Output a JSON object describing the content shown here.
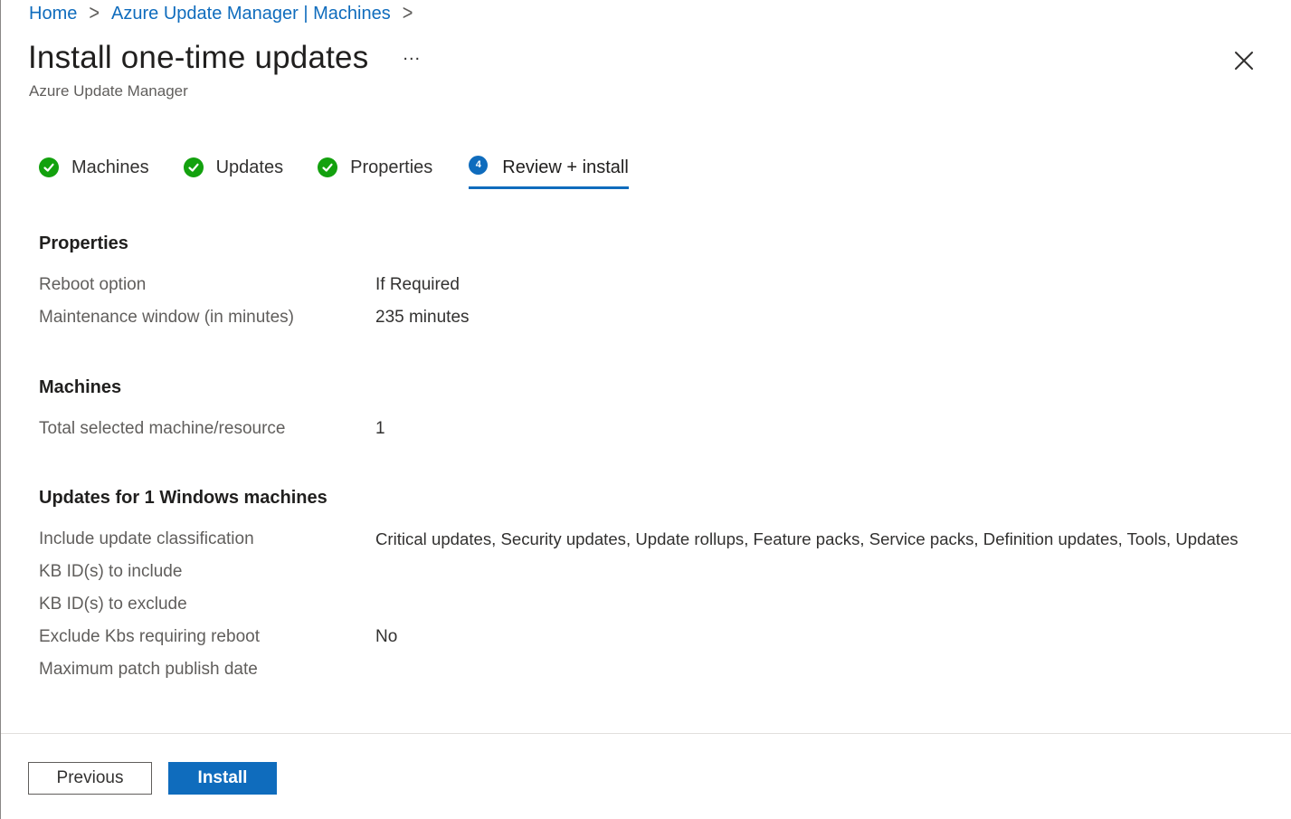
{
  "breadcrumb": {
    "items": [
      "Home",
      "Azure Update Manager | Machines"
    ],
    "separator": ">"
  },
  "header": {
    "title": "Install one-time updates",
    "more": "...",
    "subtitle": "Azure Update Manager"
  },
  "tabs": [
    {
      "label": "Machines",
      "state": "complete"
    },
    {
      "label": "Updates",
      "state": "complete"
    },
    {
      "label": "Properties",
      "state": "complete"
    },
    {
      "label": "Review + install",
      "state": "active",
      "number": "4"
    }
  ],
  "sections": {
    "properties": {
      "heading": "Properties",
      "rows": [
        {
          "label": "Reboot option",
          "value": "If Required"
        },
        {
          "label": "Maintenance window (in minutes)",
          "value": "235 minutes"
        }
      ]
    },
    "machines": {
      "heading": "Machines",
      "rows": [
        {
          "label": "Total selected machine/resource",
          "value": "1"
        }
      ]
    },
    "updates": {
      "heading": "Updates for 1 Windows machines",
      "rows": [
        {
          "label": "Include update classification",
          "value": "Critical updates, Security updates, Update rollups, Feature packs, Service packs, Definition updates, Tools, Updates"
        },
        {
          "label": "KB ID(s) to include",
          "value": ""
        },
        {
          "label": "KB ID(s) to exclude",
          "value": ""
        },
        {
          "label": "Exclude Kbs requiring reboot",
          "value": "No"
        },
        {
          "label": "Maximum patch publish date",
          "value": ""
        }
      ]
    }
  },
  "footer": {
    "previous_label": "Previous",
    "install_label": "Install"
  },
  "colors": {
    "accent": "#0f6cbd",
    "success": "#13a10e"
  }
}
